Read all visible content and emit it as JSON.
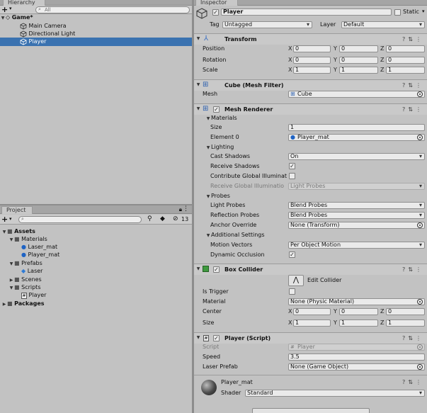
{
  "hierarchy": {
    "tab_label": "Hierarchy",
    "add_label": "+",
    "search_placeholder": "All",
    "scene_name": "Game*",
    "items": [
      {
        "label": "Main Camera"
      },
      {
        "label": "Directional Light"
      },
      {
        "label": "Player"
      }
    ]
  },
  "project": {
    "tab_label": "Project",
    "add_label": "+",
    "hidden_count": "13",
    "tree": [
      {
        "label": "Assets",
        "bold": true
      },
      {
        "label": "Materials"
      },
      {
        "label": "Laser_mat"
      },
      {
        "label": "Player_mat"
      },
      {
        "label": "Prefabs"
      },
      {
        "label": "Laser"
      },
      {
        "label": "Scenes"
      },
      {
        "label": "Scripts"
      },
      {
        "label": "Player"
      },
      {
        "label": "Packages",
        "bold": true
      }
    ]
  },
  "inspector": {
    "tab_label": "Inspector",
    "object_name": "Player",
    "static_label": "Static",
    "tag_label": "Tag",
    "tag_value": "Untagged",
    "layer_label": "Layer",
    "layer_value": "Default",
    "transform": {
      "title": "Transform",
      "rows": [
        {
          "label": "Position",
          "x": "0",
          "y": "0",
          "z": "0"
        },
        {
          "label": "Rotation",
          "x": "0",
          "y": "0",
          "z": "0"
        },
        {
          "label": "Scale",
          "x": "1",
          "y": "1",
          "z": "1"
        }
      ],
      "x_label": "X",
      "y_label": "Y",
      "z_label": "Z"
    },
    "mesh_filter": {
      "title": "Cube (Mesh Filter)",
      "mesh_label": "Mesh",
      "mesh_value": "Cube"
    },
    "mesh_renderer": {
      "title": "Mesh Renderer",
      "materials_label": "Materials",
      "size_label": "Size",
      "size_value": "1",
      "element0_label": "Element 0",
      "element0_value": "Player_mat",
      "lighting_label": "Lighting",
      "cast_shadows_label": "Cast Shadows",
      "cast_shadows_value": "On",
      "receive_shadows_label": "Receive Shadows",
      "contribute_gi_label": "Contribute Global Illuminat",
      "receive_gi_label": "Receive Global Illuminatio",
      "receive_gi_value": "Light Probes",
      "probes_label": "Probes",
      "light_probes_label": "Light Probes",
      "light_probes_value": "Blend Probes",
      "reflection_probes_label": "Reflection Probes",
      "reflection_probes_value": "Blend Probes",
      "anchor_override_label": "Anchor Override",
      "anchor_override_value": "None (Transform)",
      "additional_label": "Additional Settings",
      "motion_vectors_label": "Motion Vectors",
      "motion_vectors_value": "Per Object Motion",
      "dynamic_occlusion_label": "Dynamic Occlusion"
    },
    "box_collider": {
      "title": "Box Collider",
      "edit_label": "Edit Collider",
      "is_trigger_label": "Is Trigger",
      "material_label": "Material",
      "material_value": "None (Physic Material)",
      "center_label": "Center",
      "center": {
        "x": "0",
        "y": "0",
        "z": "0"
      },
      "size_label": "Size",
      "size": {
        "x": "1",
        "y": "1",
        "z": "1"
      }
    },
    "player_script": {
      "title": "Player (Script)",
      "script_label": "Script",
      "script_value": "Player",
      "speed_label": "Speed",
      "speed_value": "3.5",
      "laser_prefab_label": "Laser Prefab",
      "laser_prefab_value": "None (Game Object)"
    },
    "material": {
      "name": "Player_mat",
      "shader_label": "Shader",
      "shader_value": "Standard"
    }
  },
  "colors": {
    "selection": "#3a72b0",
    "panel": "#c2c2c2",
    "header": "#c9c9c9"
  }
}
